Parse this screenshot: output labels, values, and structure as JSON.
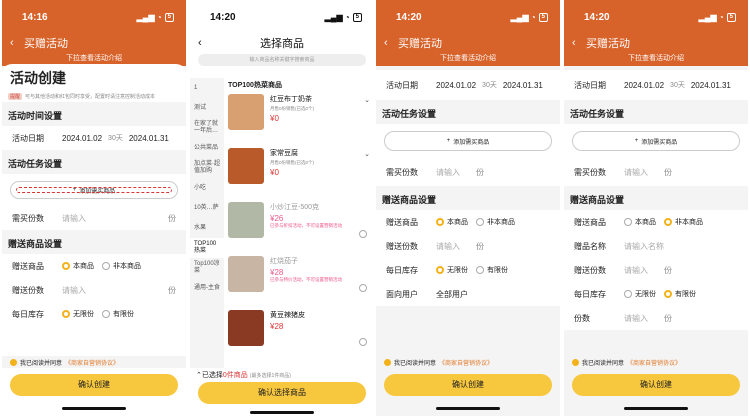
{
  "statusbar": [
    {
      "time": "14:16",
      "battery": "5"
    },
    {
      "time": "14:20",
      "battery": "5"
    },
    {
      "time": "14:20",
      "battery": "5"
    },
    {
      "time": "14:20",
      "battery": "5"
    }
  ],
  "nav": {
    "title": "买赠活动",
    "subtitle": "下拉查看活动介绍",
    "pick_title": "选择商品"
  },
  "create": {
    "heading": "活动创建",
    "tip_tag": "提醒",
    "tip": "可与其他活动和红包同时享受，配置时请注意控制活动成本",
    "sec_time": "活动时间设置",
    "date_label": "活动日期",
    "date_start": "2024.01.02",
    "date_days": "30天",
    "date_end": "2024.01.31",
    "sec_task": "活动任务设置",
    "add_goods": "添加需买商品",
    "buy_qty_label": "需买份数",
    "input_ph": "请输入",
    "unit_fen": "份",
    "sec_gift": "赠送商品设置",
    "gift_goods_label": "赠送商品",
    "opt_this": "本商品",
    "opt_other": "非本商品",
    "gift_qty_label": "赠送份数",
    "stock_label": "每日库存",
    "opt_unlimited": "无限份",
    "opt_limited": "有限份",
    "target_label": "面向用户",
    "target_value": "全部用户",
    "gift_name_label": "赠品名称",
    "gift_name_ph": "请输入名称",
    "qty_label": "份数",
    "agree_text": "我已阅读并同意",
    "agree_link": "《商家自营销协议》",
    "confirm": "确认创建"
  },
  "picker": {
    "search_ph": "输入商品名称关键字搜索商品",
    "categories": [
      "1",
      "测试",
      "在家了就一年后…",
      "公共菜品",
      "加点菜·超值加购",
      "小吃",
      "10英…萨",
      "水果",
      "TOP100热菜",
      "Top100凉菜",
      "通用-主食"
    ],
    "group_title": "TOP100热菜商品",
    "products": [
      {
        "name": "红豆布丁奶茶",
        "meta": "月售0份销售(已选0个)",
        "price": "¥0",
        "warn": "",
        "img": "#d8a070"
      },
      {
        "name": "家常豆腐",
        "meta": "月售0份销售(已选0个)",
        "price": "¥0",
        "warn": "",
        "img": "#b85a2a"
      },
      {
        "name": "小炒江豆-500克",
        "meta": "",
        "price": "¥26",
        "warn": "已参与折扣活动，不可设置营销活动",
        "img": "#7d8a6a"
      },
      {
        "name": "红烧茄子",
        "meta": "",
        "price": "¥28",
        "warn": "已参与特价活动，不可设置营销活动",
        "img": "#a58468"
      },
      {
        "name": "黄豆辣猪皮",
        "meta": "",
        "price": "¥28",
        "warn": "",
        "img": "#8a3a22"
      }
    ],
    "selected_prefix": "已选择",
    "selected_count": "0件商品",
    "selected_hint": "(最多选择1件商品)",
    "confirm": "确认选择商品"
  },
  "colors": {
    "brand": "#d8632a",
    "accent": "#f7c73e",
    "warn": "#d33"
  }
}
